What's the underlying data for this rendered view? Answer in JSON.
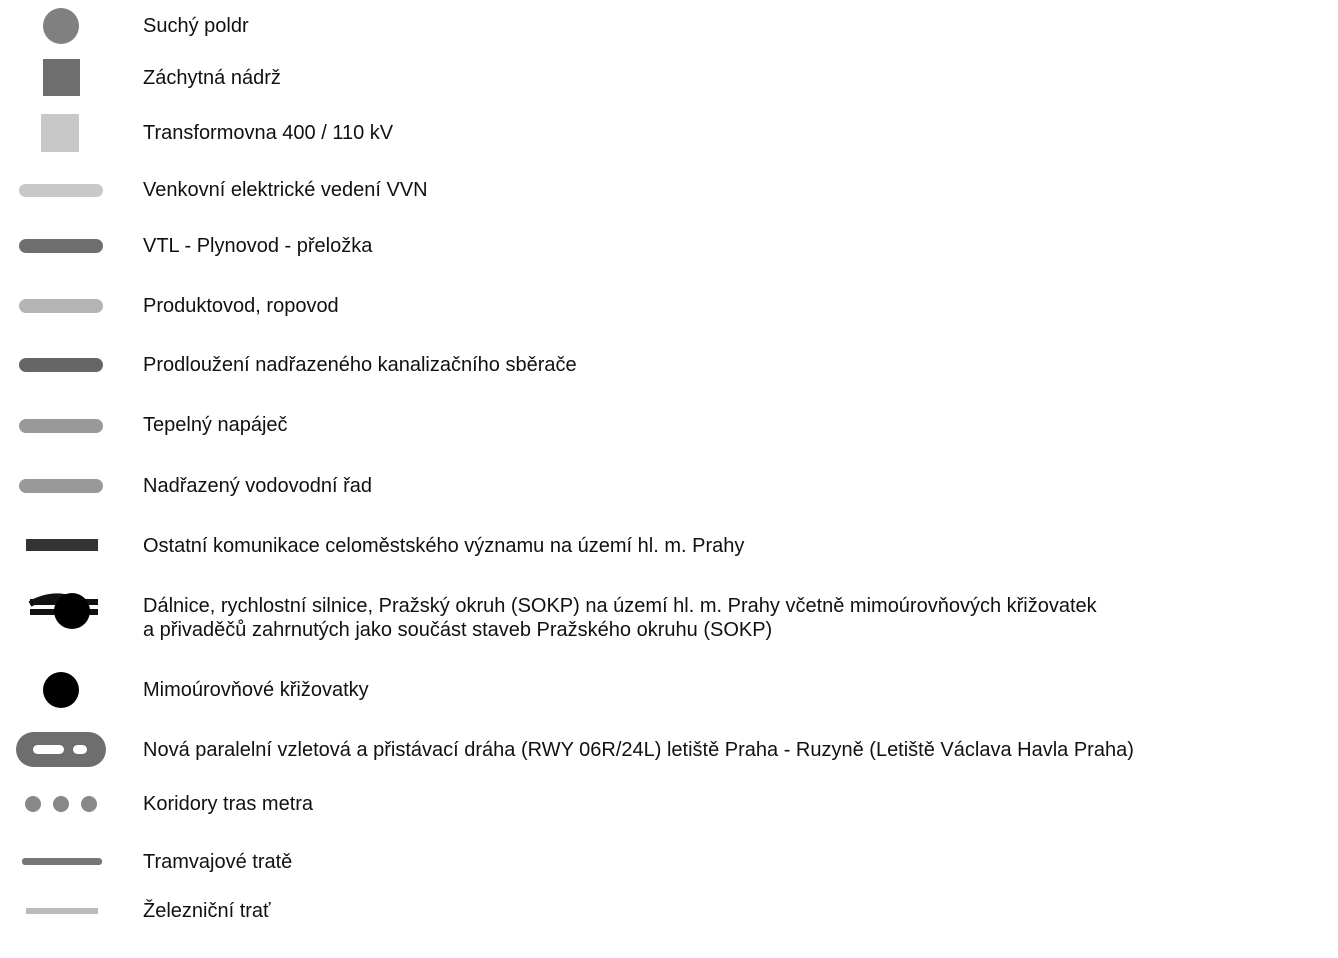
{
  "legend": {
    "items": [
      {
        "id": "dry-polder",
        "label": "Suchý poldr",
        "icon": "circle-icon",
        "color": "#808080"
      },
      {
        "id": "retention-tank",
        "label": "Záchytná nádrž",
        "icon": "square-icon",
        "color": "#6e6e6e"
      },
      {
        "id": "transformer-station",
        "label": "Transformovna 400 / 110 kV",
        "icon": "square-icon",
        "color": "#c8c8c8"
      },
      {
        "id": "power-line",
        "label": "Venkovní elektrické vedení VVN",
        "icon": "rounded-line-icon",
        "color": "#c8c8c8"
      },
      {
        "id": "gas-pipeline",
        "label": "VTL - Plynovod - přeložka",
        "icon": "rounded-line-icon",
        "color": "#6e6e6e"
      },
      {
        "id": "oil-pipeline",
        "label": "Produktovod, ropovod",
        "icon": "rounded-line-icon",
        "color": "#b4b4b4"
      },
      {
        "id": "sewer-extension",
        "label": "Prodloužení nadřazeného kanalizačního sběrače",
        "icon": "rounded-line-icon",
        "color": "#666666"
      },
      {
        "id": "heat-feeder",
        "label": "Tepelný napáječ",
        "icon": "rounded-line-icon",
        "color": "#999999"
      },
      {
        "id": "water-main",
        "label": "Nadřazený vodovodní řad",
        "icon": "rounded-line-icon",
        "color": "#999999"
      },
      {
        "id": "city-roads",
        "label": "Ostatní komunikace celoměstského významu na území hl. m. Prahy",
        "icon": "thick-line-icon",
        "color": "#333333"
      },
      {
        "id": "highways",
        "label": "Dálnice, rychlostní silnice, Pražský okruh (SOKP) na území hl. m. Prahy včetně mimoúrovňových křižovatek\na přivaděčů zahrnutých jako součást staveb Pražského okruhu (SOKP)",
        "icon": "highway-interchange-icon",
        "color": "#111111"
      },
      {
        "id": "interchanges",
        "label": "Mimoúrovňové křižovatky",
        "icon": "circle-icon",
        "color": "#000000"
      },
      {
        "id": "runway",
        "label": "Nová paralelní vzletová a přistávací dráha (RWY 06R/24L) letiště Praha - Ruzyně (Letiště Václava Havla Praha)",
        "icon": "runway-icon",
        "color": "#6e6e6e"
      },
      {
        "id": "metro-corridors",
        "label": "Koridory tras metra",
        "icon": "dotted-line-icon",
        "color": "#888888"
      },
      {
        "id": "tram-lines",
        "label": "Tramvajové tratě",
        "icon": "line-icon",
        "color": "#777777"
      },
      {
        "id": "railway",
        "label": "Železniční trať",
        "icon": "line-icon",
        "color": "#bbbbbb"
      }
    ]
  }
}
